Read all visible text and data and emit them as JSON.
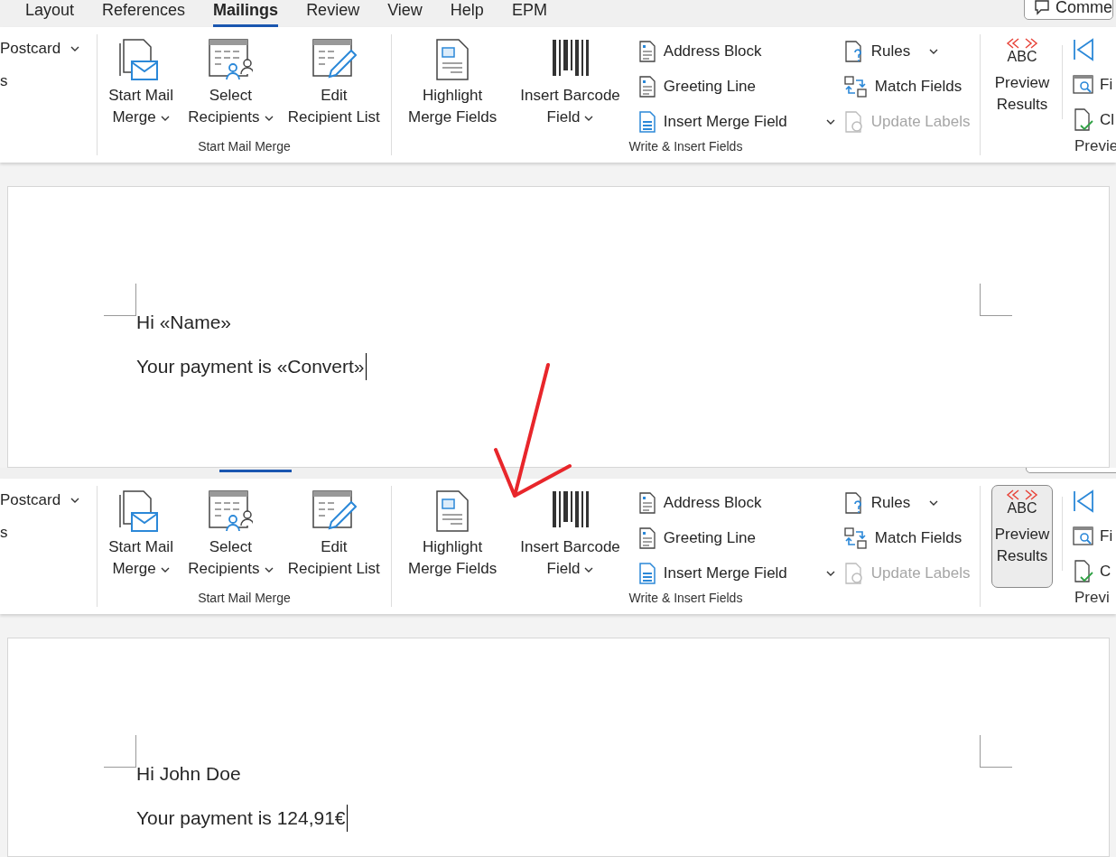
{
  "panels": [
    {
      "tabs": [
        {
          "label": "Layout",
          "selected": false
        },
        {
          "label": "References",
          "selected": false
        },
        {
          "label": "Mailings",
          "selected": true
        },
        {
          "label": "Review",
          "selected": false
        },
        {
          "label": "View",
          "selected": false
        },
        {
          "label": "Help",
          "selected": false
        },
        {
          "label": "EPM",
          "selected": false
        }
      ],
      "comments_button": "Comme",
      "ribbon": {
        "left_partial": {
          "label": "Postcard",
          "fragment": "s"
        },
        "start_group": {
          "label": "Start Mail Merge",
          "buttons": [
            {
              "kind": "mail-merge",
              "lines": [
                "Start Mail",
                "Merge"
              ],
              "dropdown": true
            },
            {
              "kind": "recipients",
              "lines": [
                "Select",
                "Recipients"
              ],
              "dropdown": true
            },
            {
              "kind": "edit-list",
              "lines": [
                "Edit",
                "Recipient List"
              ],
              "dropdown": false
            }
          ]
        },
        "write_group": {
          "label": "Write & Insert Fields",
          "large_buttons": [
            {
              "kind": "highlight",
              "lines": [
                "Highlight",
                "Merge Fields"
              ],
              "dropdown": false
            },
            {
              "kind": "barcode",
              "lines": [
                "Insert Barcode",
                "Field"
              ],
              "dropdown": true
            }
          ],
          "column_1": [
            {
              "kind": "address",
              "label": "Address Block",
              "dropdown": false,
              "disabled": false
            },
            {
              "kind": "address",
              "label": "Greeting Line",
              "dropdown": false,
              "disabled": false
            },
            {
              "kind": "insert-field",
              "label": "Insert Merge Field",
              "dropdown": true,
              "disabled": false
            }
          ],
          "column_2": [
            {
              "kind": "rules",
              "label": "Rules",
              "dropdown": true,
              "disabled": false
            },
            {
              "kind": "match",
              "label": "Match Fields",
              "dropdown": false,
              "disabled": false
            },
            {
              "kind": "update",
              "label": "Update Labels",
              "dropdown": false,
              "disabled": true
            }
          ]
        },
        "preview_group": {
          "label": "Previe",
          "button": {
            "icon_text": "ABC",
            "lines": [
              "Preview",
              "Results"
            ],
            "selected": false
          },
          "fragments": [
            "Fi",
            "Cl"
          ]
        }
      },
      "document": {
        "paragraphs": [
          {
            "text": "Hi «Name»",
            "caret": false
          },
          {
            "text": "Your payment is «Convert»",
            "caret": true
          }
        ]
      }
    },
    {
      "ribbon": {
        "left_partial": {
          "label": "Postcard",
          "fragment": "s"
        },
        "start_group": {
          "label": "Start Mail Merge",
          "buttons": [
            {
              "kind": "mail-merge",
              "lines": [
                "Start Mail",
                "Merge"
              ],
              "dropdown": true
            },
            {
              "kind": "recipients",
              "lines": [
                "Select",
                "Recipients"
              ],
              "dropdown": true
            },
            {
              "kind": "edit-list",
              "lines": [
                "Edit",
                "Recipient List"
              ],
              "dropdown": false
            }
          ]
        },
        "write_group": {
          "label": "Write & Insert Fields",
          "large_buttons": [
            {
              "kind": "highlight",
              "lines": [
                "Highlight",
                "Merge Fields"
              ],
              "dropdown": false
            },
            {
              "kind": "barcode",
              "lines": [
                "Insert Barcode",
                "Field"
              ],
              "dropdown": true
            }
          ],
          "column_1": [
            {
              "kind": "address",
              "label": "Address Block",
              "dropdown": false,
              "disabled": false
            },
            {
              "kind": "address",
              "label": "Greeting Line",
              "dropdown": false,
              "disabled": false
            },
            {
              "kind": "insert-field",
              "label": "Insert Merge Field",
              "dropdown": true,
              "disabled": false
            }
          ],
          "column_2": [
            {
              "kind": "rules",
              "label": "Rules",
              "dropdown": true,
              "disabled": false
            },
            {
              "kind": "match",
              "label": "Match Fields",
              "dropdown": false,
              "disabled": false
            },
            {
              "kind": "update",
              "label": "Update Labels",
              "dropdown": false,
              "disabled": true
            }
          ]
        },
        "preview_group": {
          "label": "Previ",
          "button": {
            "icon_text": "ABC",
            "lines": [
              "Preview",
              "Results"
            ],
            "selected": true
          },
          "fragments": [
            "Fi",
            "C"
          ]
        }
      },
      "document": {
        "paragraphs": [
          {
            "text": "Hi John Doe",
            "caret": false
          },
          {
            "text": "Your payment is 124,91€",
            "caret": true
          }
        ]
      }
    }
  ]
}
